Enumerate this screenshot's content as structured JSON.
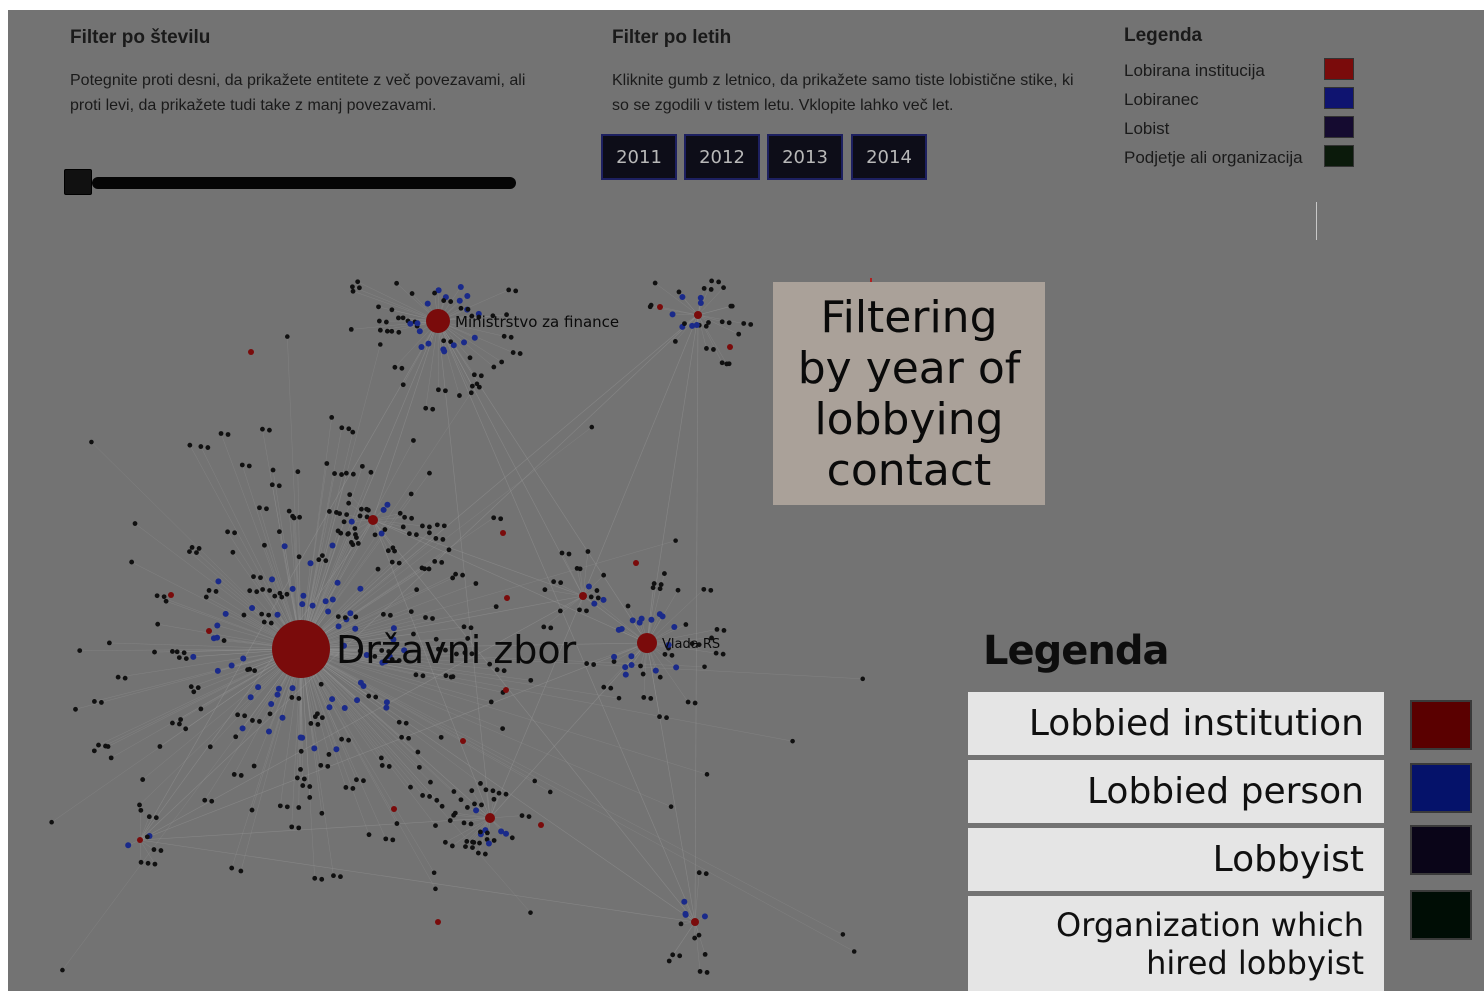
{
  "filter_count": {
    "title": "Filter po številu",
    "description": "Potegnite proti desni, da prikažete entitete z več povezavami, ali proti levi, da prikažete tudi take z manj povezavami.",
    "slider_value": 0
  },
  "filter_year": {
    "title": "Filter po letih",
    "description": "Kliknite gumb z letnico, da prikažete samo tiste lobistične stike, ki so se zgodili v tistem letu. Vklopite lahko več let.",
    "years": [
      "2011",
      "2012",
      "2013",
      "2014"
    ]
  },
  "legend": {
    "title": "Legenda",
    "items": [
      {
        "label": "Lobirana institucija",
        "color": "#7a0b0b"
      },
      {
        "label": "Lobiranec",
        "color": "#0f1470"
      },
      {
        "label": "Lobist",
        "color": "#150b30"
      },
      {
        "label": "Podjetje ali organizacija",
        "color": "#0b1a0b"
      }
    ]
  },
  "graph": {
    "labels": [
      "Državni zbor",
      "Ministrstvo za finance",
      "Vlada RS"
    ],
    "colors": {
      "institution": "#7a0b0b",
      "person": "#1a2a8a",
      "lobbyist": "#101010",
      "edge": "#9a9a9a"
    }
  },
  "callout": {
    "lines": [
      "Filtering",
      "by year of",
      "lobbying",
      "contact"
    ]
  },
  "english_legend": {
    "title": "Legenda",
    "items": [
      {
        "label": "Lobbied institution",
        "color": "#5a0000"
      },
      {
        "label": "Lobbied person",
        "color": "#05126a"
      },
      {
        "label": "Lobbyist",
        "color": "#0a0518"
      },
      {
        "label_line1": "Organization which",
        "label_line2": "hired lobbyist",
        "color": "#000d05"
      }
    ]
  }
}
